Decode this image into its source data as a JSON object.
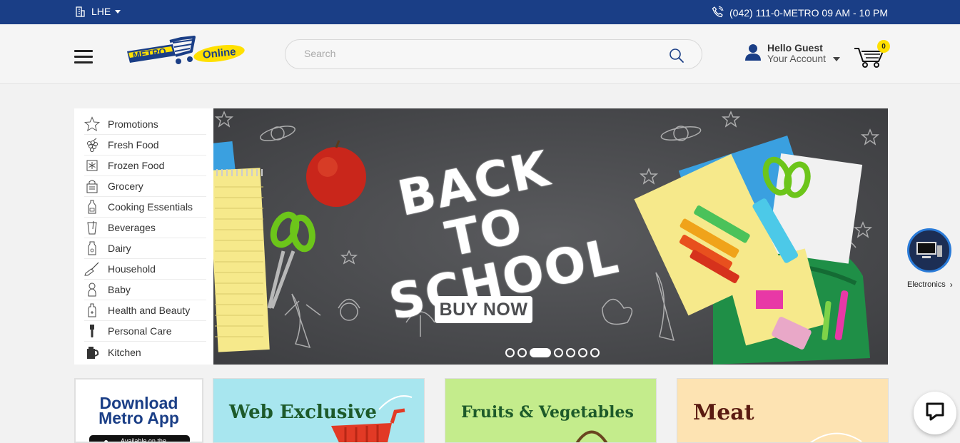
{
  "topbar": {
    "city": "LHE",
    "phone": "(042) 111-0-METRO 09 AM - 10 PM"
  },
  "header": {
    "logo_text_left": "METRO",
    "logo_text_right": "Online",
    "search_placeholder": "Search",
    "account_greeting": "Hello Guest",
    "account_label": "Your Account",
    "cart_count": "0"
  },
  "categories": [
    {
      "label": "Promotions",
      "icon": "star-icon"
    },
    {
      "label": "Fresh Food",
      "icon": "grapes-icon"
    },
    {
      "label": "Frozen Food",
      "icon": "snowflake-icon"
    },
    {
      "label": "Grocery",
      "icon": "grocery-bag-icon"
    },
    {
      "label": "Cooking Essentials",
      "icon": "oil-bottle-icon"
    },
    {
      "label": "Beverages",
      "icon": "cup-icon"
    },
    {
      "label": "Dairy",
      "icon": "milk-bottle-icon"
    },
    {
      "label": "Household",
      "icon": "broom-icon"
    },
    {
      "label": "Baby",
      "icon": "baby-icon"
    },
    {
      "label": "Health and Beauty",
      "icon": "lotion-icon"
    },
    {
      "label": "Personal Care",
      "icon": "razor-icon"
    },
    {
      "label": "Kitchen",
      "icon": "kettle-icon"
    }
  ],
  "banner": {
    "headline_line1": "BACK TO",
    "headline_line2": "SCHOOL",
    "cta": "BUY NOW",
    "slide_count": 7,
    "active_slide": 3
  },
  "floating": {
    "electronics_label": "Electronics"
  },
  "cards": {
    "app_title_line1": "Download",
    "app_title_line2": "Metro App",
    "app_store_text": "Available on the",
    "web_title": "Web Exclusive",
    "fruit_title": "Fruits & Vegetables",
    "meat_title": "Meat"
  },
  "colors": {
    "brand_blue": "#1a3e86",
    "brand_yellow": "#ffe000",
    "banner_bg": "#4c4d50"
  }
}
